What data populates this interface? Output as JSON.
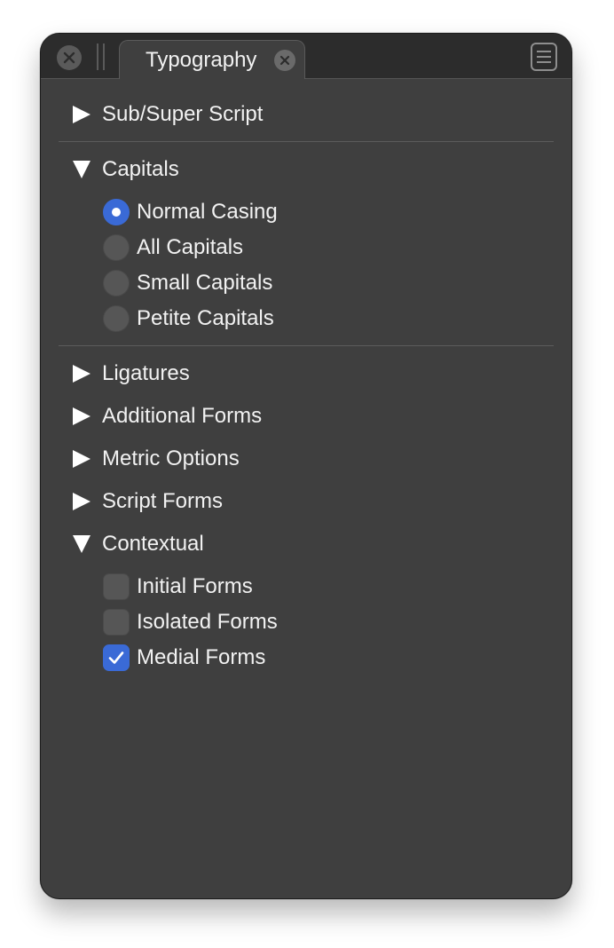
{
  "tab": {
    "title": "Typography"
  },
  "sections": {
    "sub_super": {
      "label": "Sub/Super Script",
      "expanded": false
    },
    "capitals": {
      "label": "Capitals",
      "expanded": true,
      "options": [
        {
          "label": "Normal Casing",
          "selected": true
        },
        {
          "label": "All Capitals",
          "selected": false
        },
        {
          "label": "Small Capitals",
          "selected": false
        },
        {
          "label": "Petite Capitals",
          "selected": false
        }
      ]
    },
    "ligatures": {
      "label": "Ligatures",
      "expanded": false
    },
    "additional_forms": {
      "label": "Additional Forms",
      "expanded": false
    },
    "metric_options": {
      "label": "Metric Options",
      "expanded": false
    },
    "script_forms": {
      "label": "Script Forms",
      "expanded": false
    },
    "contextual": {
      "label": "Contextual",
      "expanded": true,
      "options": [
        {
          "label": "Initial Forms",
          "checked": false
        },
        {
          "label": "Isolated Forms",
          "checked": false
        },
        {
          "label": "Medial Forms",
          "checked": true
        }
      ]
    }
  },
  "icons": {
    "close": "close-icon",
    "grip": "grip-icon",
    "tab_close": "close-icon",
    "menu": "menu-icon",
    "collapsed": "triangle-right-icon",
    "expanded": "triangle-down-icon",
    "check": "checkmark-icon"
  },
  "colors": {
    "panel_bg": "#3f3f3f",
    "tabbar_bg": "#2c2c2c",
    "accent": "#3a6ad6",
    "text": "#f2f2f2"
  }
}
